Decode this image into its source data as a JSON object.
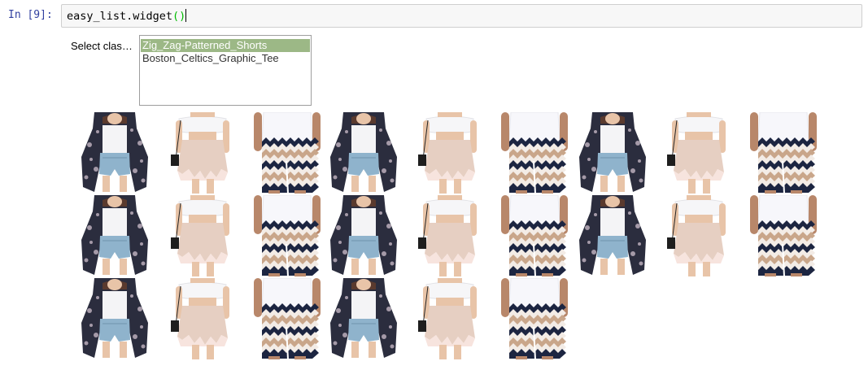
{
  "cell": {
    "prompt": "In [9]:",
    "code_fn": "easy_list.widget",
    "code_parens": "()"
  },
  "widget": {
    "label": "Select clas…",
    "options": [
      {
        "label": "Zig_Zag-Patterned_Shorts",
        "selected": true
      },
      {
        "label": "Boston_Celtics_Graphic_Tee",
        "selected": false
      }
    ],
    "selected_color": "#9cb886"
  },
  "gallery": {
    "rows": [
      [
        "kimono-denim-shorts",
        "off-shoulder-blush-skirt",
        "zigzag-shorts",
        "kimono-denim-shorts",
        "off-shoulder-blush-skirt",
        "zigzag-shorts",
        "kimono-denim-shorts",
        "off-shoulder-blush-skirt",
        "zigzag-shorts"
      ],
      [
        "kimono-denim-shorts",
        "off-shoulder-blush-skirt",
        "zigzag-shorts",
        "kimono-denim-shorts",
        "off-shoulder-blush-skirt",
        "zigzag-shorts",
        "kimono-denim-shorts",
        "off-shoulder-blush-skirt",
        "zigzag-shorts"
      ],
      [
        "kimono-denim-shorts",
        "off-shoulder-blush-skirt",
        "zigzag-shorts",
        "kimono-denim-shorts",
        "off-shoulder-blush-skirt",
        "zigzag-shorts"
      ]
    ]
  }
}
